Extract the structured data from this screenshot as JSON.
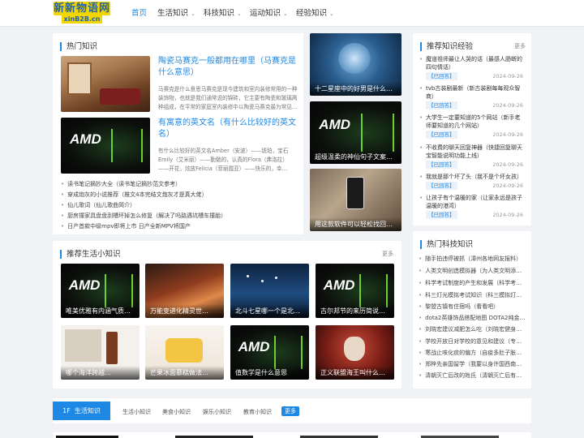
{
  "logo": {
    "top": "新新物语网",
    "bottom": "xinB2B.cn"
  },
  "nav": [
    {
      "label": "首页"
    },
    {
      "label": "生活知识"
    },
    {
      "label": "科技知识"
    },
    {
      "label": "运动知识"
    },
    {
      "label": "经验知识"
    }
  ],
  "hot": {
    "title": "热门知识",
    "items": [
      {
        "title": "陶瓷马赛克一般都用在哪里（马赛克是什么意思）",
        "desc": "马赛克是什么意思马赛克是现今建筑和室内装修常用的一种装饰物，也就是我们通常说的锦砖，它主要有陶瓷和玻璃两种组成，在平常的家庭室内装修中以陶瓷马赛克最为常见…"
      },
      {
        "title": "有寓意的英文名（有什么比较好的英文名）",
        "desc": "有什么比较好的英文名Amber（安波）——琥珀，宝石 Emily（艾米丽）——勤勉的，认真的Flora（弗洛拉）——开花，炫放Felicia（菲丽霞亚）——快乐的，幸…"
      }
    ],
    "list": [
      "读书笔记摘抄大全（读书笔记摘抄范文参考）",
      "穿成炮灰的小说推荐（推文4本完结文炮灰才是真大佬）",
      "仙儿歌词（仙儿歌曲简介）",
      "厨房撞家具盘盘刮槽坏掉怎么修复（解决了吗路遇坑槽车撞胎）",
      "日产首款中级mpv即将上市 日产全新MPV将国产"
    ]
  },
  "mid_cards": [
    {
      "caption": "十二星座中的好男是什么…"
    },
    {
      "caption": "超级温柔的神仙句子文案…"
    },
    {
      "caption": "用这款软件可以轻松找回…"
    }
  ],
  "rec_exp": {
    "title": "推荐知识经验",
    "more": "更多",
    "badge_label": "【已回答】",
    "items": [
      {
        "title": "魔道祖师最让人哭的话（最感人肠断的四句情话）",
        "date": "2024-09-26"
      },
      {
        "title": "tvb古装剧最新（新古装剧每每观众智商）",
        "date": "2024-09-26"
      },
      {
        "title": "大学生一定要知道的5个网站（新手老师要知道的几个网站）",
        "date": "2024-09-26"
      },
      {
        "title": "不收费的聊天回复神器（快捷回复聊天宝智能说明功能上线）",
        "date": "2024-09-26"
      },
      {
        "title": "我就是那个坏了头（我不是个坏女孩）",
        "date": "2024-09-26"
      },
      {
        "title": "让孩子有个温暖的家（让家永远是孩子温暖的港湾）",
        "date": "2024-09-26"
      }
    ]
  },
  "hot_tech": {
    "title": "热门科技知识",
    "items": [
      "随手拍违停被抓（漳州各地网友报料）",
      "人类文明创造模拟器（为人类文明添…",
      "科学考试制度的产生和发展（科学考…",
      "科三灯光模拟考试知识（科三模拟灯…",
      "黎盟古镇有住宿吗（看看吧）",
      "dota2英雄饰品搭配地图 DOTA2纯金…",
      "刘晓宏建议减肥怎么吃（刘晓宏健身…",
      "学校开放日对学校的意见和建议（专…",
      "寒战止咳化痰的偏方（自疫多肚子胀…",
      "郑梓先亲国留学（我要以身许国西南…",
      "清朝灭亡后改的姓氏（清朝灭亡后有…"
    ]
  },
  "rec_life": {
    "title": "推荐生活小知识",
    "more": "更多",
    "cards": [
      {
        "caption": "唯美优雅有内涵气质…"
      },
      {
        "caption": "万能变进化精灵世…"
      },
      {
        "caption": "北斗七星哪一个是北…"
      },
      {
        "caption": "古尔邦节的来历简说…"
      },
      {
        "caption": "哪个海洋跨越…"
      },
      {
        "caption": "芒果冰面慕糕做法…"
      },
      {
        "caption": "值数学是什么意思"
      },
      {
        "caption": "正义联盟海王叫什么…"
      }
    ]
  },
  "floor": {
    "label": "1F  生活知识",
    "tabs": [
      "生活小知识",
      "美食小知识",
      "娱乐小知识",
      "教育小知识"
    ],
    "more": "更多"
  }
}
